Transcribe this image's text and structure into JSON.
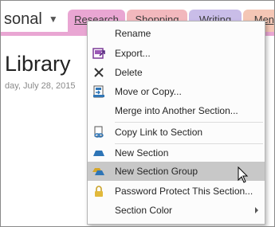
{
  "notebook": {
    "name": "sonal",
    "caret": "▼"
  },
  "tabs": [
    "Research",
    "Shopping",
    "Writing",
    "Meng"
  ],
  "page": {
    "title": "Library",
    "date": "day, July 28, 2015"
  },
  "menu": {
    "items": [
      {
        "label": "Rename",
        "icon": "none"
      },
      {
        "label": "Export...",
        "icon": "export-icon"
      },
      {
        "label": "Delete",
        "icon": "delete-x-icon"
      },
      {
        "label": "Move or Copy...",
        "icon": "move-copy-icon"
      },
      {
        "label": "Merge into Another Section...",
        "icon": "none"
      },
      {
        "label": "Copy Link to Section",
        "icon": "link-icon"
      },
      {
        "label": "New Section",
        "icon": "section-tab-icon"
      },
      {
        "label": "New Section Group",
        "icon": "section-group-icon"
      },
      {
        "label": "Password Protect This Section...",
        "icon": "lock-icon"
      },
      {
        "label": "Section Color",
        "icon": "none"
      }
    ]
  },
  "colors": {
    "research_tab": "#e9a6d3",
    "shopping_tab": "#f2b8bd",
    "writing_tab": "#c9bde8",
    "highlight": "#c8c8c8"
  }
}
